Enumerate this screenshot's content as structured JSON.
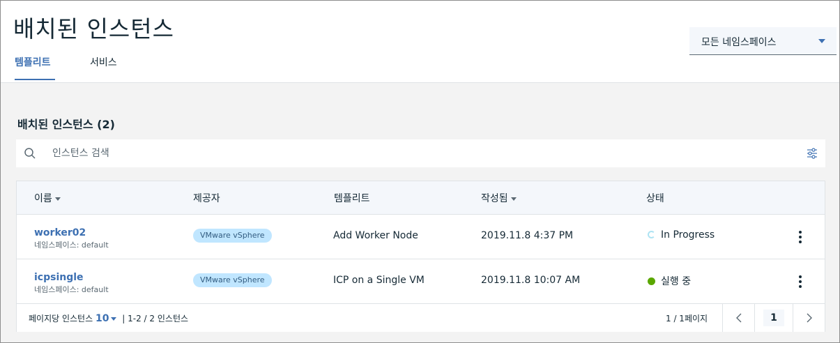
{
  "header": {
    "title": "배치된 인스턴스",
    "tabs": [
      {
        "label": "템플리트",
        "active": true
      },
      {
        "label": "서비스",
        "active": false
      }
    ],
    "namespace_select": {
      "value": "모든 네임스페이스"
    }
  },
  "section": {
    "title": "배치된 인스턴스 (2)"
  },
  "search": {
    "placeholder": "인스턴스 검색",
    "value": ""
  },
  "table": {
    "columns": [
      "이름",
      "제공자",
      "템플리트",
      "작성됨",
      "상태"
    ],
    "rows": [
      {
        "name": "worker02",
        "namespace": "네임스페이스: default",
        "provider": "VMware vSphere",
        "template": "Add Worker Node",
        "created": "2019.11.8 4:37 PM",
        "status": "In Progress"
      },
      {
        "name": "icpsingle",
        "namespace": "네임스페이스: default",
        "provider": "VMware vSphere",
        "template": "ICP on a Single VM",
        "created": "2019.11.8 10:07 AM",
        "status": "실행 중"
      }
    ]
  },
  "pagination": {
    "per_page_label": "페이지당 인스턴스",
    "per_page_value": "10",
    "range_label": "| 1-2 / 2 인스턴스",
    "page_info": "1 / 1페이지",
    "current_page": "1"
  },
  "icons": {
    "search": "search-icon",
    "filter": "filter-settings-icon",
    "prev": "chevron-left-icon",
    "next": "chevron-right-icon",
    "overflow": "overflow-menu-icon"
  },
  "colors": {
    "accent": "#3d70b2",
    "tag_bg": "#c0e6ff",
    "running": "#5aa700",
    "in_progress": "#aee3f3"
  }
}
